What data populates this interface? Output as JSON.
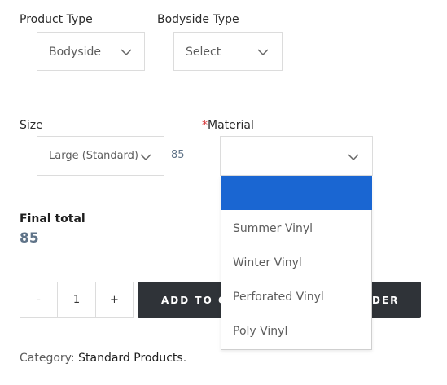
{
  "product_type": {
    "label": "Product Type",
    "value": "Bodyside"
  },
  "bodyside_type": {
    "label": "Bodyside Type",
    "value": "Select"
  },
  "size": {
    "label": "Size",
    "value": "Large (Standard)",
    "price": "85"
  },
  "material": {
    "required_mark": "*",
    "label": "Material",
    "value": "",
    "options": [
      "",
      "Summer Vinyl",
      "Winter Vinyl",
      "Perforated Vinyl",
      "Poly Vinyl"
    ]
  },
  "final_total": {
    "label": "Final total",
    "value": "85"
  },
  "quantity": {
    "minus": "-",
    "value": "1",
    "plus": "+"
  },
  "add_to_cart": {
    "label_left": "ADD TO CA",
    "label_right": "DER"
  },
  "category": {
    "prefix": "Category: ",
    "link": "Standard Products",
    "suffix": "."
  },
  "colors": {
    "accent": "#1a66d2",
    "button_bg": "#2f3338",
    "price": "#5f7388"
  }
}
